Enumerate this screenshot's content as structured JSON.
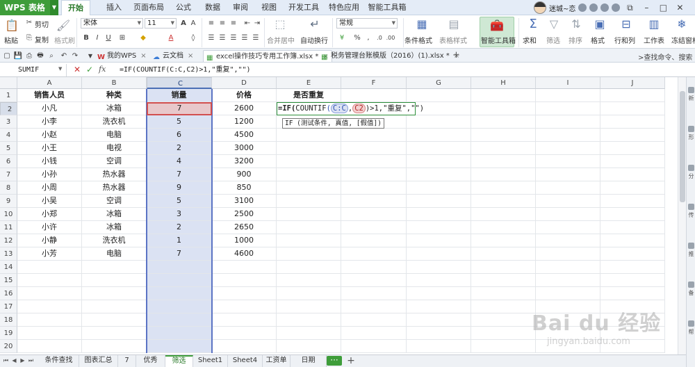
{
  "app": {
    "name": "WPS 表格"
  },
  "menu_tabs": [
    "开始",
    "插入",
    "页面布局",
    "公式",
    "数据",
    "审阅",
    "视图",
    "开发工具",
    "特色应用",
    "智能工具箱"
  ],
  "user": {
    "name": "迷城~恋"
  },
  "ribbon": {
    "paste": "粘贴",
    "cut": "剪切",
    "copy": "复制",
    "format_painter": "格式刷",
    "font_name": "宋体",
    "font_size": "11",
    "merge_center": "合并居中",
    "wrap_text": "自动换行",
    "number_format": "常规",
    "conditional_format": "条件格式",
    "table_style": "表格样式",
    "smart_toolbox": "智能工具箱",
    "sum": "求和",
    "filter": "筛选",
    "sort": "排序",
    "format": "格式",
    "row_col": "行和列",
    "worksheet": "工作表",
    "freeze": "冻结窗格"
  },
  "doc_tabs": [
    {
      "label": "我的WPS"
    },
    {
      "label": "云文档"
    },
    {
      "label": "excel操作技巧专用工作簿.xlsx *"
    },
    {
      "label": "税务管理台账模版（2016）(1).xlsx *"
    }
  ],
  "search_hint": "查找命令、搜索",
  "formula_bar": {
    "name_box": "SUMIF",
    "formula": "=IF(COUNTIF(C:C,C2)>1,\"重复\",\"\")"
  },
  "columns": [
    "A",
    "B",
    "C",
    "D",
    "E",
    "F",
    "G",
    "H",
    "I",
    "J"
  ],
  "rows": [
    "1",
    "2",
    "3",
    "4",
    "5",
    "6",
    "7",
    "8",
    "9",
    "10",
    "11",
    "12",
    "13",
    "14",
    "15",
    "16",
    "17",
    "18",
    "19",
    "20"
  ],
  "table": {
    "headers": [
      "销售人员",
      "种类",
      "销量",
      "价格",
      "是否重复"
    ],
    "rows": [
      [
        "小凡",
        "冰箱",
        "7",
        "2600"
      ],
      [
        "小李",
        "洗衣机",
        "5",
        "1200"
      ],
      [
        "小赵",
        "电脑",
        "6",
        "4500"
      ],
      [
        "小王",
        "电视",
        "2",
        "3000"
      ],
      [
        "小钱",
        "空调",
        "4",
        "3200"
      ],
      [
        "小孙",
        "热水器",
        "7",
        "900"
      ],
      [
        "小周",
        "热水器",
        "9",
        "850"
      ],
      [
        "小吴",
        "空调",
        "5",
        "3100"
      ],
      [
        "小郑",
        "冰箱",
        "3",
        "2500"
      ],
      [
        "小许",
        "冰箱",
        "2",
        "2650"
      ],
      [
        "小静",
        "洗衣机",
        "1",
        "1000"
      ],
      [
        "小芳",
        "电脑",
        "7",
        "4600"
      ]
    ]
  },
  "edit_cell": {
    "prefix": "=IF(",
    "fn": "COUNTIF",
    "open": "(",
    "ref1": "C:C",
    "comma": ",",
    "ref2": "C2",
    "suffix": ")>1,\"重复\",\"\")"
  },
  "tooltip": "IF (测试条件, 真值, [假值])",
  "sheet_tabs": [
    "条件查找",
    "图表汇总",
    "7",
    "优秀",
    "筛选",
    "Sheet1",
    "Sheet4",
    "工资单",
    "日期"
  ],
  "active_sheet": "筛选",
  "right_panel": [
    "新",
    "形",
    "分",
    "传",
    "推",
    "备",
    "帮"
  ],
  "watermark": {
    "brand": "Bai du 经验",
    "url": "jingyan.baidu.com"
  }
}
